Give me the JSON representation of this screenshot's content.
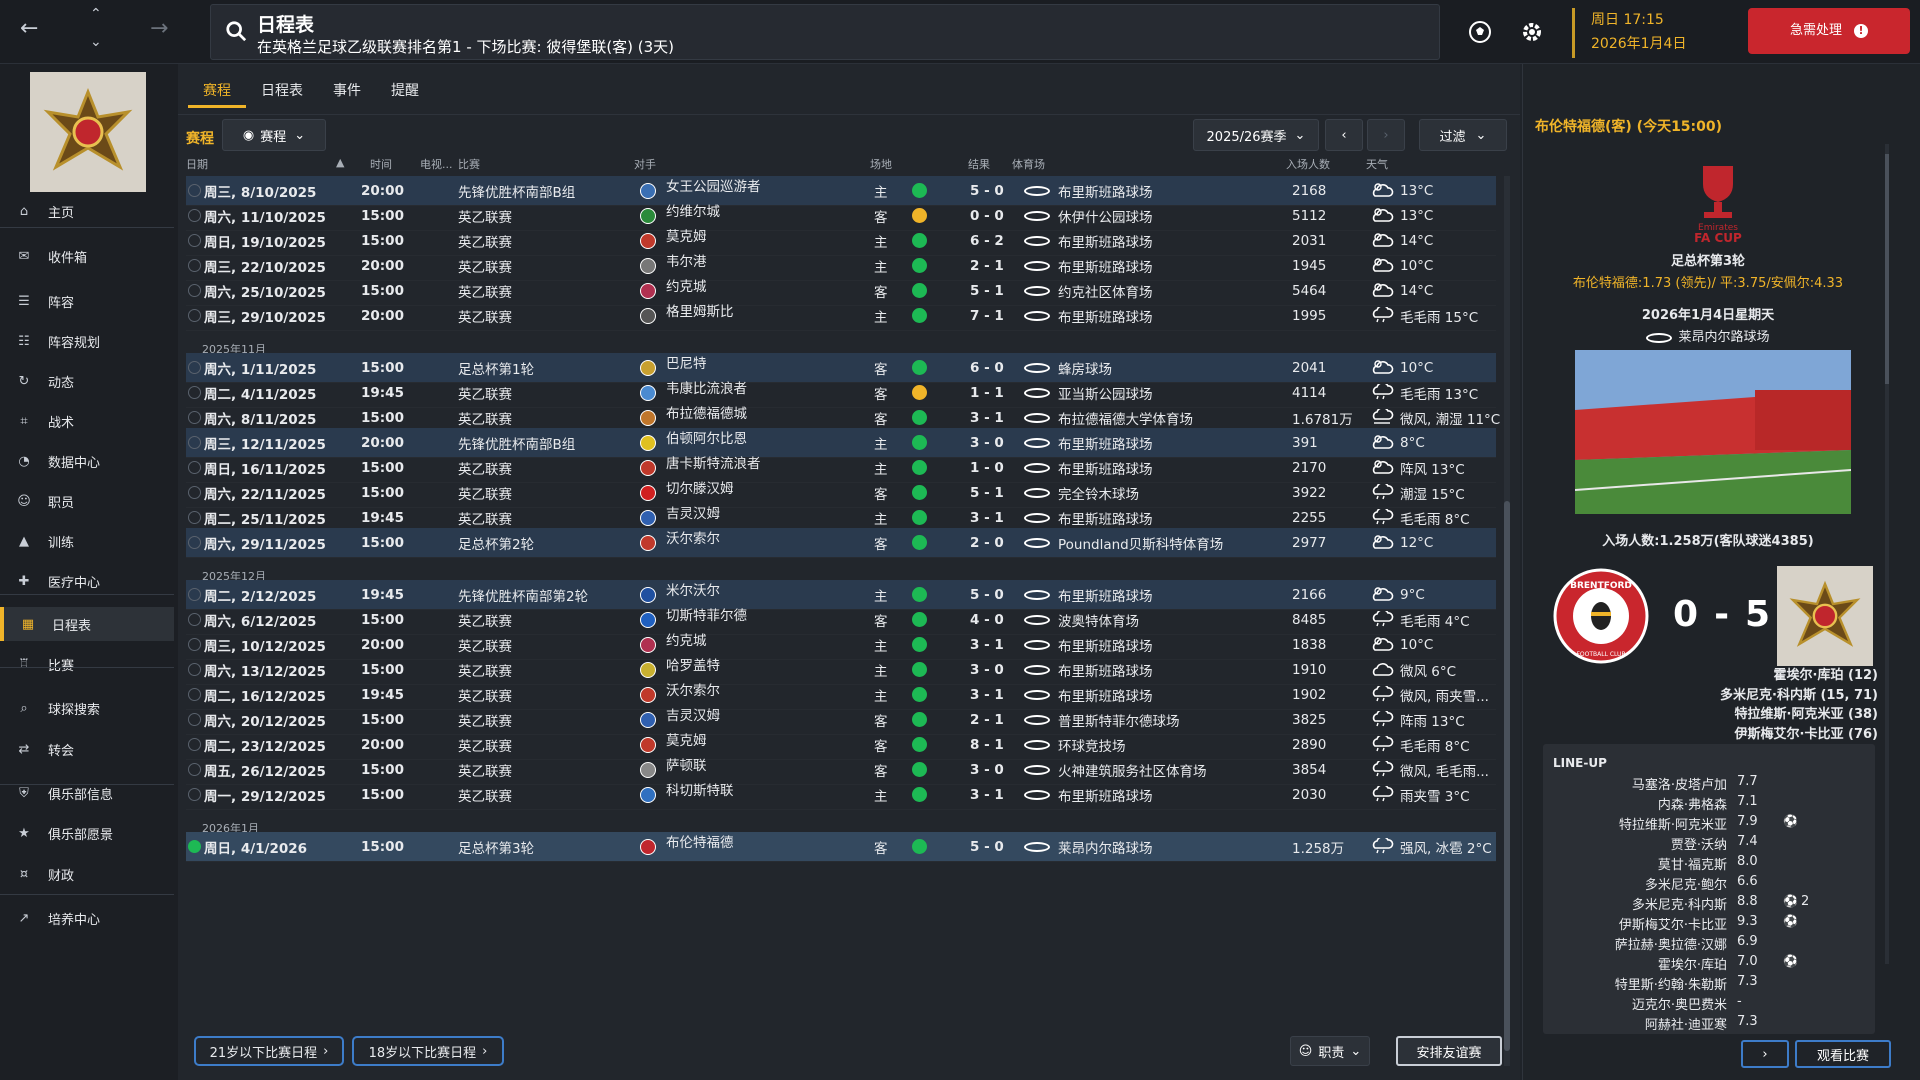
{
  "header": {
    "title": "日程表",
    "subtitle": "在英格兰足球乙级联赛排名第1 - 下场比赛: 彼得堡联(客) (3天)",
    "date_line1": "周日 17:15",
    "date_line2": "2026年1月4日",
    "urgent_label": "急需处理",
    "urgent_icon": "!"
  },
  "sidebar": {
    "items": [
      {
        "label": "主页",
        "icon": "home-icon"
      },
      {
        "label": "收件箱",
        "icon": "inbox-icon"
      },
      {
        "label": "阵容",
        "icon": "squad-icon"
      },
      {
        "label": "阵容规划",
        "icon": "clipboard-icon"
      },
      {
        "label": "动态",
        "icon": "dynamics-icon"
      },
      {
        "label": "战术",
        "icon": "tactics-icon"
      },
      {
        "label": "数据中心",
        "icon": "data-icon"
      },
      {
        "label": "职员",
        "icon": "staff-icon"
      },
      {
        "label": "训练",
        "icon": "training-icon"
      },
      {
        "label": "医疗中心",
        "icon": "medical-icon"
      },
      {
        "label": "日程表",
        "icon": "calendar-icon"
      },
      {
        "label": "比赛",
        "icon": "trophy-icon"
      },
      {
        "label": "球探搜索",
        "icon": "scout-icon"
      },
      {
        "label": "转会",
        "icon": "transfer-icon"
      },
      {
        "label": "俱乐部信息",
        "icon": "shield-icon"
      },
      {
        "label": "俱乐部愿景",
        "icon": "vision-icon"
      },
      {
        "label": "财政",
        "icon": "finance-icon"
      },
      {
        "label": "培养中心",
        "icon": "development-icon"
      }
    ]
  },
  "tabs": [
    "赛程",
    "日程表",
    "事件",
    "提醒"
  ],
  "subbar": {
    "label": "赛程",
    "view_pill": "赛程",
    "season": "2025/26赛季",
    "filter": "过滤"
  },
  "columns": {
    "date": "日期",
    "time": "时间",
    "tv": "电视...",
    "comp": "比赛",
    "opp": "对手",
    "venue": "场地",
    "result": "结果",
    "stadium": "体育场",
    "att": "入场人数",
    "weather": "天气"
  },
  "colors": {
    "accent": "#f0b429",
    "win": "#1db954",
    "draw": "#f0b429",
    "highlight_row": "#2a3a4e",
    "urgent": "#c9262d"
  },
  "fixtures": [
    {
      "kind": "row",
      "date": "周三, 8/10/2025",
      "time": "20:00",
      "comp": "先锋优胜杯南部B组",
      "opp": "女王公园巡游者",
      "venue": "主",
      "res": "W",
      "score": "5 - 0",
      "stadium": "布里斯班路球场",
      "att": "2168",
      "wx": "13°C",
      "wxi": "cloud-sun",
      "hl": true,
      "badge": "#3a6fb3"
    },
    {
      "kind": "row",
      "date": "周六, 11/10/2025",
      "time": "15:00",
      "comp": "英乙联赛",
      "opp": "约维尔城",
      "venue": "客",
      "res": "D",
      "score": "0 - 0",
      "stadium": "休伊什公园球场",
      "att": "5112",
      "wx": "13°C",
      "wxi": "cloud-sun",
      "badge": "#2a8a3a"
    },
    {
      "kind": "row",
      "date": "周日, 19/10/2025",
      "time": "15:00",
      "comp": "英乙联赛",
      "opp": "莫克姆",
      "venue": "主",
      "res": "W",
      "score": "6 - 2",
      "stadium": "布里斯班路球场",
      "att": "2031",
      "wx": "14°C",
      "wxi": "cloud-sun",
      "badge": "#c0392b"
    },
    {
      "kind": "row",
      "date": "周三, 22/10/2025",
      "time": "20:00",
      "comp": "英乙联赛",
      "opp": "韦尔港",
      "venue": "主",
      "res": "W",
      "score": "2 - 1",
      "stadium": "布里斯班路球场",
      "att": "1945",
      "wx": "10°C",
      "wxi": "cloud-sun",
      "badge": "#777777"
    },
    {
      "kind": "row",
      "date": "周六, 25/10/2025",
      "time": "15:00",
      "comp": "英乙联赛",
      "opp": "约克城",
      "venue": "客",
      "res": "W",
      "score": "5 - 1",
      "stadium": "约克社区体育场",
      "att": "5464",
      "wx": "14°C",
      "wxi": "cloud-sun",
      "badge": "#b03050"
    },
    {
      "kind": "row",
      "date": "周三, 29/10/2025",
      "time": "20:00",
      "comp": "英乙联赛",
      "opp": "格里姆斯比",
      "venue": "主",
      "res": "W",
      "score": "7 - 1",
      "stadium": "布里斯班路球场",
      "att": "1995",
      "wx": "毛毛雨 15°C",
      "wxi": "rain",
      "badge": "#555555"
    },
    {
      "kind": "month",
      "label": "2025年11月"
    },
    {
      "kind": "row",
      "date": "周六, 1/11/2025",
      "time": "15:00",
      "comp": "足总杯第1轮",
      "opp": "巴尼特",
      "venue": "客",
      "res": "W",
      "score": "6 - 0",
      "stadium": "蜂房球场",
      "att": "2041",
      "wx": "10°C",
      "wxi": "cloud-sun",
      "hl": true,
      "badge": "#c8a030"
    },
    {
      "kind": "row",
      "date": "周二, 4/11/2025",
      "time": "19:45",
      "comp": "英乙联赛",
      "opp": "韦康比流浪者",
      "venue": "客",
      "res": "D",
      "score": "1 - 1",
      "stadium": "亚当斯公园球场",
      "att": "4114",
      "wx": "毛毛雨 13°C",
      "wxi": "rain",
      "badge": "#4a8ad0"
    },
    {
      "kind": "row",
      "date": "周六, 8/11/2025",
      "time": "15:00",
      "comp": "英乙联赛",
      "opp": "布拉德福德城",
      "venue": "客",
      "res": "W",
      "score": "3 - 1",
      "stadium": "布拉德福德大学体育场",
      "att": "1.6781万",
      "wx": "微风, 潮湿 11°C",
      "wxi": "wind",
      "badge": "#c0762b"
    },
    {
      "kind": "row",
      "date": "周三, 12/11/2025",
      "time": "20:00",
      "comp": "先锋优胜杯南部B组",
      "opp": "伯顿阿尔比恩",
      "venue": "主",
      "res": "W",
      "score": "3 - 0",
      "stadium": "布里斯班路球场",
      "att": "391",
      "wx": "8°C",
      "wxi": "cloud-sun",
      "hl": true,
      "badge": "#e0c020"
    },
    {
      "kind": "row",
      "date": "周日, 16/11/2025",
      "time": "15:00",
      "comp": "英乙联赛",
      "opp": "唐卡斯特流浪者",
      "venue": "主",
      "res": "W",
      "score": "1 - 0",
      "stadium": "布里斯班路球场",
      "att": "2170",
      "wx": "阵风 13°C",
      "wxi": "cloud-sun",
      "badge": "#c0392b"
    },
    {
      "kind": "row",
      "date": "周六, 22/11/2025",
      "time": "15:00",
      "comp": "英乙联赛",
      "opp": "切尔滕汉姆",
      "venue": "客",
      "res": "W",
      "score": "5 - 1",
      "stadium": "完全铃木球场",
      "att": "3922",
      "wx": "潮湿 15°C",
      "wxi": "rain",
      "badge": "#d02020"
    },
    {
      "kind": "row",
      "date": "周二, 25/11/2025",
      "time": "19:45",
      "comp": "英乙联赛",
      "opp": "吉灵汉姆",
      "venue": "主",
      "res": "W",
      "score": "3 - 1",
      "stadium": "布里斯班路球场",
      "att": "2255",
      "wx": "毛毛雨 8°C",
      "wxi": "rain",
      "badge": "#3060b0"
    },
    {
      "kind": "row",
      "date": "周六, 29/11/2025",
      "time": "15:00",
      "comp": "足总杯第2轮",
      "opp": "沃尔索尔",
      "venue": "客",
      "res": "W",
      "score": "2 - 0",
      "stadium": "Poundland贝斯科特体育场",
      "att": "2977",
      "wx": "12°C",
      "wxi": "cloud-sun",
      "hl": true,
      "badge": "#c0392b"
    },
    {
      "kind": "month",
      "label": "2025年12月"
    },
    {
      "kind": "row",
      "date": "周二, 2/12/2025",
      "time": "19:45",
      "comp": "先锋优胜杯南部第2轮",
      "opp": "米尔沃尔",
      "venue": "主",
      "res": "W",
      "score": "5 - 0",
      "stadium": "布里斯班路球场",
      "att": "2166",
      "wx": "9°C",
      "wxi": "cloud-sun",
      "hl": true,
      "badge": "#2050a0"
    },
    {
      "kind": "row",
      "date": "周六, 6/12/2025",
      "time": "15:00",
      "comp": "英乙联赛",
      "opp": "切斯特菲尔德",
      "venue": "客",
      "res": "W",
      "score": "4 - 0",
      "stadium": "波奥特体育场",
      "att": "8485",
      "wx": "毛毛雨 4°C",
      "wxi": "rain",
      "badge": "#2060c0"
    },
    {
      "kind": "row",
      "date": "周三, 10/12/2025",
      "time": "20:00",
      "comp": "英乙联赛",
      "opp": "约克城",
      "venue": "主",
      "res": "W",
      "score": "3 - 1",
      "stadium": "布里斯班路球场",
      "att": "1838",
      "wx": "10°C",
      "wxi": "cloud-sun",
      "badge": "#b03050"
    },
    {
      "kind": "row",
      "date": "周六, 13/12/2025",
      "time": "15:00",
      "comp": "英乙联赛",
      "opp": "哈罗盖特",
      "venue": "主",
      "res": "W",
      "score": "3 - 0",
      "stadium": "布里斯班路球场",
      "att": "1910",
      "wx": "微风 6°C",
      "wxi": "cloud",
      "badge": "#c8b030"
    },
    {
      "kind": "row",
      "date": "周二, 16/12/2025",
      "time": "19:45",
      "comp": "英乙联赛",
      "opp": "沃尔索尔",
      "venue": "主",
      "res": "W",
      "score": "3 - 1",
      "stadium": "布里斯班路球场",
      "att": "1902",
      "wx": "微风, 雨夹雪...",
      "wxi": "rain",
      "badge": "#c0392b"
    },
    {
      "kind": "row",
      "date": "周六, 20/12/2025",
      "time": "15:00",
      "comp": "英乙联赛",
      "opp": "吉灵汉姆",
      "venue": "客",
      "res": "W",
      "score": "2 - 1",
      "stadium": "普里斯特菲尔德球场",
      "att": "3825",
      "wx": "阵雨 13°C",
      "wxi": "rain",
      "badge": "#3060b0"
    },
    {
      "kind": "row",
      "date": "周二, 23/12/2025",
      "time": "20:00",
      "comp": "英乙联赛",
      "opp": "莫克姆",
      "venue": "客",
      "res": "W",
      "score": "8 - 1",
      "stadium": "环球竞技场",
      "att": "2890",
      "wx": "毛毛雨 8°C",
      "wxi": "rain",
      "badge": "#c0392b"
    },
    {
      "kind": "row",
      "date": "周五, 26/12/2025",
      "time": "15:00",
      "comp": "英乙联赛",
      "opp": "萨顿联",
      "venue": "客",
      "res": "W",
      "score": "3 - 0",
      "stadium": "火神建筑服务社区体育场",
      "att": "3854",
      "wx": "微风, 毛毛雨...",
      "wxi": "rain",
      "badge": "#888888"
    },
    {
      "kind": "row",
      "date": "周一, 29/12/2025",
      "time": "15:00",
      "comp": "英乙联赛",
      "opp": "科切斯特联",
      "venue": "主",
      "res": "W",
      "score": "3 - 1",
      "stadium": "布里斯班路球场",
      "att": "2030",
      "wx": "雨夹雪 3°C",
      "wxi": "rain",
      "badge": "#3070c0"
    },
    {
      "kind": "month",
      "label": "2026年1月"
    },
    {
      "kind": "row",
      "date": "周日, 4/1/2026",
      "time": "15:00",
      "comp": "足总杯第3轮",
      "opp": "布伦特福德",
      "venue": "客",
      "res": "W",
      "score": "5 - 0",
      "stadium": "莱昂内尔路球场",
      "att": "1.258万",
      "wx": "强风, 冰雹 2°C",
      "wxi": "rain",
      "sel": true,
      "done": true,
      "badge": "#c0262d"
    }
  ],
  "bottom_buttons": [
    "21岁以下比赛日程",
    "18岁以下比赛日程"
  ],
  "bottom_right": {
    "staff": "职责",
    "friendly": "安排友谊赛"
  },
  "match_panel": {
    "header": "布伦特福德(客) (今天15:00)",
    "competition": "足总杯第3轮",
    "cup_logo_text": "Emirates\nFA CUP",
    "odds": "布伦特福德:1.73 (领先)/ 平:3.75/安佩尔:4.33",
    "date": "2026年1月4日星期天",
    "stadium": "莱昂内尔路球场",
    "attendance": "入场人数:1.258万(客队球迷4385)",
    "home_score": "0",
    "sep": "-",
    "away_score": "5",
    "home_badge_text": "BRENTFORD",
    "home_badge_sub": "FOOTBALL CLUB",
    "scorers": [
      "霍埃尔·库珀 (12)",
      "多米尼克·科内斯 (15, 71)",
      "特拉维斯·阿克米亚 (38)",
      "伊斯梅艾尔·卡比亚 (76)"
    ],
    "lineup_title": "LINE-UP",
    "lineup": [
      {
        "name": "马塞洛·皮塔卢加",
        "rating": "7.7",
        "extra": ""
      },
      {
        "name": "内森·弗格森",
        "rating": "7.1",
        "extra": ""
      },
      {
        "name": "特拉维斯·阿克米亚",
        "rating": "7.9",
        "extra": "ball"
      },
      {
        "name": "贾登·沃纳",
        "rating": "7.4",
        "extra": ""
      },
      {
        "name": "莫甘·福克斯",
        "rating": "8.0",
        "extra": ""
      },
      {
        "name": "多米尼克·鲍尔",
        "rating": "6.6",
        "extra": ""
      },
      {
        "name": "多米尼克·科内斯",
        "rating": "8.8",
        "extra": "ball2"
      },
      {
        "name": "伊斯梅艾尔·卡比亚",
        "rating": "9.3",
        "extra": "ball"
      },
      {
        "name": "萨拉赫·奥拉德·汉娜",
        "rating": "6.9",
        "extra": ""
      },
      {
        "name": "霍埃尔·库珀",
        "rating": "7.0",
        "extra": "ball"
      },
      {
        "name": "特里斯·约翰·朱勒斯",
        "rating": "7.3",
        "extra": ""
      },
      {
        "name": "迈克尔·奥巴费米",
        "rating": "-",
        "extra": ""
      },
      {
        "name": "阿赫社·迪亚寒",
        "rating": "7.3",
        "extra": ""
      }
    ],
    "goal_count": "2",
    "watch_btn": "观看比赛"
  }
}
